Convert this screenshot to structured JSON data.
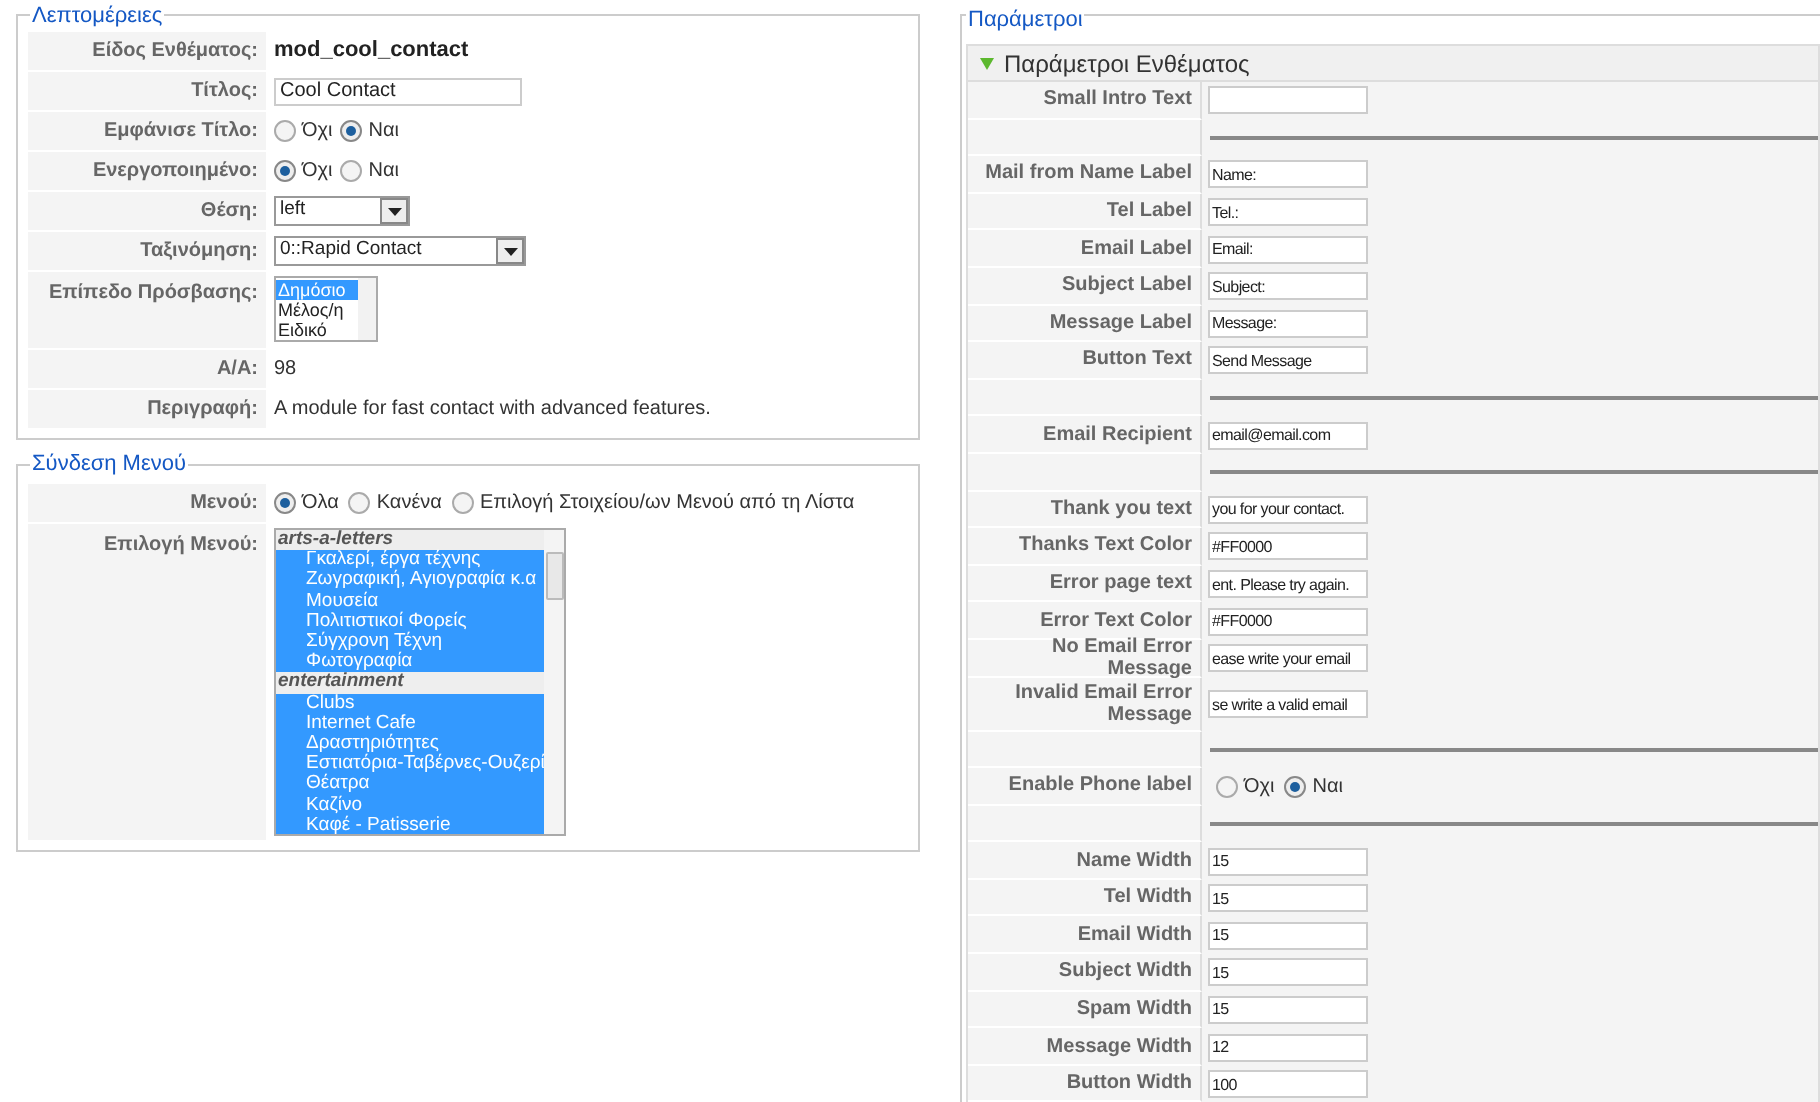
{
  "details": {
    "legend": "Λεπτομέρειες",
    "rows": [
      {
        "kind": "text",
        "label": "Είδος Ενθέματος:",
        "value": "mod_cool_contact",
        "bold": true
      },
      {
        "kind": "input",
        "label": "Τίτλος:",
        "value": "Cool Contact"
      },
      {
        "kind": "radio",
        "label": "Εμφάνισε Τίτλο:",
        "options": [
          {
            "label": "Όχι",
            "selected": false
          },
          {
            "label": "Ναι",
            "selected": true
          }
        ]
      },
      {
        "kind": "radio",
        "label": "Ενεργοποιημένο:",
        "options": [
          {
            "label": "Όχι",
            "selected": true
          },
          {
            "label": "Ναι",
            "selected": false
          }
        ]
      },
      {
        "kind": "select",
        "label": "Θέση:",
        "value": "left",
        "wide": false
      },
      {
        "kind": "select",
        "label": "Ταξινόμηση:",
        "value": "0::Rapid Contact",
        "wide": true
      },
      {
        "kind": "listbox",
        "label": "Επίπεδο Πρόσβασης:",
        "options": [
          {
            "label": "Δημόσιο",
            "selected": true
          },
          {
            "label": "Μέλος/η",
            "selected": false
          },
          {
            "label": "Ειδικό",
            "selected": false
          }
        ]
      },
      {
        "kind": "text",
        "label": "Α/Α:",
        "value": "98",
        "bold": false
      },
      {
        "kind": "text",
        "label": "Περιγραφή:",
        "value": "A module for fast contact with advanced features.",
        "bold": false
      }
    ]
  },
  "menu_assignment": {
    "legend": "Σύνδεση Μενού",
    "menus_label": "Μενού:",
    "menus_options": [
      {
        "label": "Όλα",
        "selected": true
      },
      {
        "label": "Κανένα",
        "selected": false
      },
      {
        "label": "Επιλογή Στοιχείου/ων Μενού από τη Λίστα",
        "selected": false
      }
    ],
    "selection_label": "Επιλογή Μενού:",
    "groups": [
      {
        "name": "arts-a-letters",
        "items": [
          {
            "label": "Γκαλερί, έργα τέχνης",
            "selected": true
          },
          {
            "label": "Ζωγραφική, Αγιογραφία κ.α",
            "selected": true
          },
          {
            "label": "Μουσεία",
            "selected": true
          },
          {
            "label": "Πολιτιστικοί Φορείς",
            "selected": true
          },
          {
            "label": "Σύγχρονη Τέχνη",
            "selected": true
          },
          {
            "label": "Φωτογραφία",
            "selected": true
          }
        ]
      },
      {
        "name": "entertainment",
        "items": [
          {
            "label": "Clubs",
            "selected": true
          },
          {
            "label": "Internet Cafe",
            "selected": true
          },
          {
            "label": "Δραστηριότητες",
            "selected": true
          },
          {
            "label": "Εστιατόρια-Ταβέρνες-Ουζερί",
            "selected": true
          },
          {
            "label": "Θέατρα",
            "selected": true
          },
          {
            "label": "Καζίνο",
            "selected": true
          },
          {
            "label": "Καφέ - Patisserie",
            "selected": true
          }
        ]
      }
    ]
  },
  "parameters": {
    "legend": "Παράμετροι",
    "panel_title": "Παράμετροι Ενθέματος",
    "expanded": true,
    "rows": [
      {
        "kind": "input",
        "label": "Small Intro Text",
        "value": ""
      },
      {
        "kind": "separator"
      },
      {
        "kind": "input",
        "label": "Mail from Name Label",
        "value": "Name:"
      },
      {
        "kind": "input",
        "label": "Tel Label",
        "value": "Tel.:"
      },
      {
        "kind": "input",
        "label": "Email Label",
        "value": "Email:"
      },
      {
        "kind": "input",
        "label": "Subject Label",
        "value": "Subject:"
      },
      {
        "kind": "input",
        "label": "Message Label",
        "value": "Message:"
      },
      {
        "kind": "input",
        "label": "Button Text",
        "value": "Send Message"
      },
      {
        "kind": "separator"
      },
      {
        "kind": "input",
        "label": "Email Recipient",
        "value": "email@email.com"
      },
      {
        "kind": "separator"
      },
      {
        "kind": "input",
        "label": "Thank you text",
        "value": "you for your contact."
      },
      {
        "kind": "input",
        "label": "Thanks Text Color",
        "value": "#FF0000"
      },
      {
        "kind": "input",
        "label": "Error page text",
        "value": "ent. Please try again."
      },
      {
        "kind": "input",
        "label": "Error Text Color",
        "value": "#FF0000"
      },
      {
        "kind": "input",
        "label": "No Email Error Message",
        "value": "ease write your email"
      },
      {
        "kind": "input",
        "label": "Invalid Email Error Message",
        "value": "se write a valid email",
        "tall": true
      },
      {
        "kind": "separator"
      },
      {
        "kind": "radio",
        "label": "Enable Phone label",
        "options": [
          {
            "label": "Όχι",
            "selected": false
          },
          {
            "label": "Ναι",
            "selected": true
          }
        ]
      },
      {
        "kind": "separator"
      },
      {
        "kind": "input",
        "label": "Name Width",
        "value": "15"
      },
      {
        "kind": "input",
        "label": "Tel Width",
        "value": "15"
      },
      {
        "kind": "input",
        "label": "Email Width",
        "value": "15"
      },
      {
        "kind": "input",
        "label": "Subject Width",
        "value": "15"
      },
      {
        "kind": "input",
        "label": "Spam Width",
        "value": "15"
      },
      {
        "kind": "input",
        "label": "Message Width",
        "value": "12"
      },
      {
        "kind": "input",
        "label": "Button Width",
        "value": "100"
      }
    ]
  }
}
